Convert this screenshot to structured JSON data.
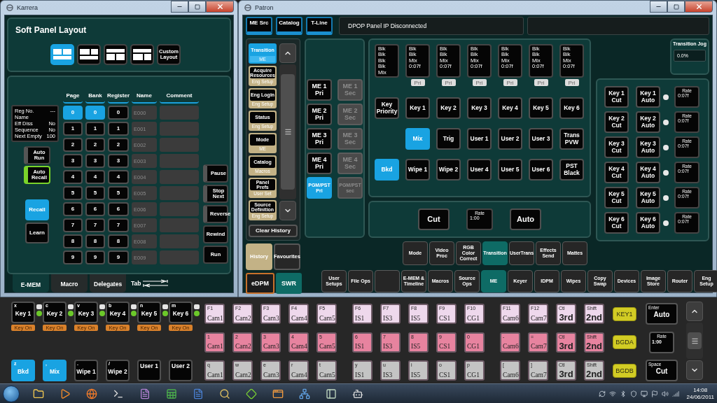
{
  "karrera": {
    "title": "Karrera",
    "layout_panel": {
      "title": "Soft Panel Layout",
      "layouts": [
        {
          "kind": "two-over-one",
          "selected": true
        },
        {
          "kind": "two-over-one",
          "selected": false
        },
        {
          "kind": "one-over-two",
          "selected": false
        },
        {
          "kind": "one-over-two",
          "selected": false
        },
        {
          "kind": "text",
          "label": "Custom Layout",
          "selected": false
        }
      ]
    },
    "info": [
      {
        "label": "Reg No.",
        "value": "---"
      },
      {
        "label": "Name"
      },
      {
        "label": "Eff Diss",
        "value": "No"
      },
      {
        "label": "Sequence",
        "value": "No"
      },
      {
        "label": "Next Empty",
        "value": "100"
      }
    ],
    "toggles": [
      {
        "label": "Auto Run",
        "on": false
      },
      {
        "label": "Auto Recall",
        "on": true
      }
    ],
    "actions": [
      {
        "label": "Recall",
        "selected": true
      },
      {
        "label": "Learn",
        "selected": false
      }
    ],
    "register_table": {
      "columns": [
        "Page",
        "Bank",
        "Register",
        "Name",
        "Comment"
      ],
      "rows": [
        {
          "page": {
            "label": "0",
            "selected": true
          },
          "bank": {
            "label": "0",
            "selected": true
          },
          "register": {
            "label": "0",
            "selected": false
          },
          "name": "E000"
        },
        {
          "page": {
            "label": "1",
            "selected": false
          },
          "bank": {
            "label": "1",
            "selected": false
          },
          "register": {
            "label": "1",
            "selected": false
          },
          "name": "E001"
        },
        {
          "page": {
            "label": "2",
            "selected": false
          },
          "bank": {
            "label": "2",
            "selected": false
          },
          "register": {
            "label": "2",
            "selected": false
          },
          "name": "E002"
        },
        {
          "page": {
            "label": "3",
            "selected": false
          },
          "bank": {
            "label": "3",
            "selected": false
          },
          "register": {
            "label": "3",
            "selected": false
          },
          "name": "E003"
        },
        {
          "page": {
            "label": "4",
            "selected": false
          },
          "bank": {
            "label": "4",
            "selected": false
          },
          "register": {
            "label": "4",
            "selected": false
          },
          "name": "E004"
        },
        {
          "page": {
            "label": "5",
            "selected": false
          },
          "bank": {
            "label": "5",
            "selected": false
          },
          "register": {
            "label": "5",
            "selected": false
          },
          "name": "E005"
        },
        {
          "page": {
            "label": "6",
            "selected": false
          },
          "bank": {
            "label": "6",
            "selected": false
          },
          "register": {
            "label": "6",
            "selected": false
          },
          "name": "E006"
        },
        {
          "page": {
            "label": "7",
            "selected": false
          },
          "bank": {
            "label": "7",
            "selected": false
          },
          "register": {
            "label": "7",
            "selected": false
          },
          "name": "E007"
        },
        {
          "page": {
            "label": "8",
            "selected": false
          },
          "bank": {
            "label": "8",
            "selected": false
          },
          "register": {
            "label": "8",
            "selected": false
          },
          "name": "E008"
        },
        {
          "page": {
            "label": "9",
            "selected": false
          },
          "bank": {
            "label": "9",
            "selected": false
          },
          "register": {
            "label": "9",
            "selected": false
          },
          "name": "E009"
        }
      ]
    },
    "transport": [
      {
        "label": "Pause",
        "kind": "latch"
      },
      {
        "label": "Stop Next",
        "kind": "latch"
      },
      {
        "label": "Reverse",
        "kind": "latch"
      },
      {
        "label": "Rewind",
        "kind": "plain"
      },
      {
        "label": "Run",
        "kind": "plain"
      }
    ],
    "tabs": [
      {
        "label": "E-MEM",
        "selected": true
      },
      {
        "label": "Macro",
        "selected": false
      },
      {
        "label": "Delegates",
        "selected": false
      }
    ],
    "tab_hint": "Tab"
  },
  "patron": {
    "title": "Patron",
    "top_tabs": [
      "ME Src",
      "Catalog",
      "T-Line"
    ],
    "status": "DPOP Panel IP Disconnected",
    "history": [
      {
        "title": "Transition",
        "sub": "ME",
        "selected": true
      },
      {
        "title": "Acquire Resources",
        "sub": "Eng Setup",
        "selected": false
      },
      {
        "title": "Eng Login",
        "sub": "Eng Setup",
        "selected": false
      },
      {
        "title": "Status",
        "sub": "Eng Setup",
        "selected": false
      },
      {
        "title": "Mode",
        "sub": "ME",
        "selected": false
      },
      {
        "title": "Catalog",
        "sub": "Macros",
        "selected": false
      },
      {
        "title": "Panel Prefs",
        "sub": "User Set",
        "selected": false
      },
      {
        "title": "Source Definition",
        "sub": "Eng Setup",
        "selected": false
      }
    ],
    "clear_history": "Clear History",
    "history_tabs": [
      {
        "label": "History",
        "selected": true
      },
      {
        "label": "Favourites",
        "selected": false
      }
    ],
    "modes": [
      {
        "label": "eDPM",
        "selected": false
      },
      {
        "label": "SWR",
        "selected": true
      }
    ],
    "me_pri": [
      {
        "label": "ME 1 Pri",
        "selected": false
      },
      {
        "label": "ME 2 Pri",
        "selected": false
      },
      {
        "label": "ME 3 Pri",
        "selected": false
      },
      {
        "label": "ME 4 Pri",
        "selected": false
      },
      {
        "label": "PGM/PST Pri",
        "selected": true
      }
    ],
    "me_sec": [
      {
        "label": "ME 1 Sec",
        "disabled": true
      },
      {
        "label": "ME 2 Sec",
        "disabled": true
      },
      {
        "label": "ME 3 Sec",
        "disabled": true
      },
      {
        "label": "ME 4 Sec",
        "disabled": true
      },
      {
        "label": "PGM/PST sec",
        "disabled": true
      }
    ],
    "displays": [
      {
        "lines": [
          "Blk",
          "Blk",
          "Blk",
          "Blk",
          "Mix"
        ]
      },
      {
        "lines": [
          "Blk",
          "Blk",
          "Mix",
          "0:07f"
        ],
        "badge": "Pri"
      },
      {
        "lines": [
          "Blk",
          "Blk",
          "Mix",
          "0:07f"
        ],
        "badge": "Pri"
      },
      {
        "lines": [
          "Blk",
          "Blk",
          "Mix",
          "0:07f"
        ],
        "badge": "Pri"
      },
      {
        "lines": [
          "Blk",
          "Blk",
          "Mix",
          "0:07f"
        ],
        "badge": "Pri"
      },
      {
        "lines": [
          "Blk",
          "Blk",
          "Mix",
          "0:07f"
        ],
        "badge": "Pri"
      },
      {
        "lines": [
          "Blk",
          "Blk",
          "Mix",
          "0:07f"
        ],
        "badge": "Pri"
      }
    ],
    "me_grid": [
      [
        {
          "kind": "button",
          "label": "Key Priority",
          "selected": false
        },
        {
          "kind": "button",
          "label": "Key 1",
          "selected": false
        },
        {
          "kind": "button",
          "label": "Key 2",
          "selected": false
        },
        {
          "kind": "button",
          "label": "Key 3",
          "selected": false
        },
        {
          "kind": "button",
          "label": "Key 4",
          "selected": false
        },
        {
          "kind": "button",
          "label": "Key 5",
          "selected": false
        },
        {
          "kind": "button",
          "label": "Key 6",
          "selected": false
        }
      ],
      [
        {
          "kind": "blank"
        },
        {
          "kind": "button",
          "label": "Mix",
          "selected": true
        },
        {
          "kind": "button",
          "label": "Trig",
          "selected": false
        },
        {
          "kind": "button",
          "label": "User 1",
          "selected": false
        },
        {
          "kind": "button",
          "label": "User 2",
          "selected": false
        },
        {
          "kind": "button",
          "label": "User 3",
          "selected": false
        },
        {
          "kind": "button",
          "label": "Trans PVW",
          "selected": false
        }
      ],
      [
        {
          "kind": "button",
          "label": "Bkd",
          "selected": true
        },
        {
          "kind": "button",
          "label": "Wipe 1",
          "selected": false
        },
        {
          "kind": "button",
          "label": "Wipe 2",
          "selected": false
        },
        {
          "kind": "button",
          "label": "User 4",
          "selected": false
        },
        {
          "kind": "button",
          "label": "User 5",
          "selected": false
        },
        {
          "kind": "button",
          "label": "User 6",
          "selected": false
        },
        {
          "kind": "button",
          "label": "PST Black",
          "selected": false
        }
      ]
    ],
    "transition": {
      "cut": "Cut",
      "rate_label": "Rate",
      "rate": "1:00",
      "auto": "Auto"
    },
    "jog": {
      "title": "Transition Jog",
      "value": "0.0%"
    },
    "key_transitions": [
      {
        "cut": "Key 1 Cut",
        "auto": "Key 1 Auto",
        "rate_label": "Rate",
        "rate": "0:07f"
      },
      {
        "cut": "Key 2 Cut",
        "auto": "Key 2 Auto",
        "rate_label": "Rate",
        "rate": "0:07f"
      },
      {
        "cut": "Key 3 Cut",
        "auto": "Key 3 Auto",
        "rate_label": "Rate",
        "rate": "0:07f"
      },
      {
        "cut": "Key 4 Cut",
        "auto": "Key 4 Auto",
        "rate_label": "Rate",
        "rate": "0:07f"
      },
      {
        "cut": "Key 5 Cut",
        "auto": "Key 5 Auto",
        "rate_label": "Rate",
        "rate": "0:07f"
      },
      {
        "cut": "Key 6 Cut",
        "auto": "Key 6 Auto",
        "rate_label": "Rate",
        "rate": "0:07f"
      }
    ],
    "menu_top": [
      {
        "label": "Mode",
        "selected": false
      },
      {
        "label": "Video Proc",
        "selected": false
      },
      {
        "label": "RGB Color Correct",
        "selected": false
      },
      {
        "label": "Transition",
        "selected": true
      },
      {
        "label": "UserTrans",
        "selected": false
      },
      {
        "label": "Effects Send",
        "selected": false
      },
      {
        "label": "Mattes",
        "selected": false
      }
    ],
    "menu_bottom": [
      {
        "label": "User Setups",
        "selected": false
      },
      {
        "label": "File Ops",
        "selected": false
      },
      {
        "selected": false
      },
      {
        "label": "E-MEM & Timeline",
        "selected": false
      },
      {
        "label": "Macros",
        "selected": false
      },
      {
        "label": "Source Ops",
        "selected": false
      },
      {
        "label": "ME",
        "selected": true
      },
      {
        "label": "Keyer",
        "selected": false
      },
      {
        "label": "IDPM",
        "selected": false
      },
      {
        "label": "Wipes",
        "selected": false
      },
      {
        "label": "Copy Swap",
        "selected": false
      },
      {
        "label": "Devices",
        "selected": false
      },
      {
        "label": "Image Store",
        "selected": false
      },
      {
        "label": "Router",
        "selected": false
      },
      {
        "label": "Eng Setup",
        "selected": false
      }
    ]
  },
  "keyboard": {
    "keyers": [
      {
        "key": "x",
        "label": "Key 1",
        "tag": "Key On",
        "on": true
      },
      {
        "key": "c",
        "label": "Key 2",
        "tag": "Key On",
        "on": true
      },
      {
        "key": "v",
        "label": "Key 3",
        "tag": "Key On",
        "on": true
      },
      {
        "key": "b",
        "label": "Key 4",
        "tag": "Key On",
        "on": true
      },
      {
        "key": "n",
        "label": "Key 5",
        "tag": "Key On",
        "on": true
      },
      {
        "key": "m",
        "label": "Key 6",
        "tag": "Key On",
        "on": true
      }
    ],
    "transitions": [
      {
        "key": "z",
        "label": "Bkd",
        "selected": true
      },
      {
        "key": ",",
        "label": "Mix",
        "selected": true
      },
      {
        "key": ".",
        "label": "Wipe 1",
        "selected": false
      },
      {
        "key": "/",
        "label": "Wipe 2",
        "selected": false
      },
      {
        "label": "User 1",
        "selected": false
      },
      {
        "label": "User 2",
        "selected": false
      }
    ],
    "source_rows": [
      {
        "color": "#eed8ec",
        "bus": "KEY1",
        "action": {
          "key": "Enter",
          "label": "Auto"
        },
        "groups": [
          [
            {
              "kind": "source",
              "key": "F1",
              "label": "Cam1"
            },
            {
              "kind": "source",
              "key": "F2",
              "label": "Cam2"
            },
            {
              "kind": "source",
              "key": "F3",
              "label": "Cam3"
            },
            {
              "kind": "source",
              "key": "F4",
              "label": "Cam4"
            },
            {
              "kind": "source",
              "key": "F5",
              "label": "Cam5"
            }
          ],
          [
            {
              "kind": "source",
              "key": "F6",
              "label": "IS1"
            },
            {
              "kind": "source",
              "key": "F7",
              "label": "IS3"
            },
            {
              "kind": "source",
              "key": "F8",
              "label": "IS5"
            },
            {
              "kind": "source",
              "key": "F9",
              "label": "CS1"
            },
            {
              "kind": "source",
              "key": "F10",
              "label": "CG1"
            }
          ],
          [
            {
              "kind": "source",
              "key": "F11",
              "label": "Cam6"
            },
            {
              "kind": "source",
              "key": "F12",
              "label": "Cam7"
            },
            {
              "kind": "modifier",
              "key": "Ctl",
              "label": "3rd"
            },
            {
              "kind": "modifier",
              "key": "Shift",
              "label": "2nd"
            }
          ]
        ]
      },
      {
        "color": "#e7839f",
        "bus": "BGDA",
        "action": {
          "key": "Rate",
          "label": "1:00"
        },
        "groups": [
          [
            {
              "kind": "source",
              "key": "1",
              "label": "Cam1"
            },
            {
              "kind": "source",
              "key": "2",
              "label": "Cam2"
            },
            {
              "kind": "source",
              "key": "3",
              "label": "Cam3"
            },
            {
              "kind": "source",
              "key": "4",
              "label": "Cam4"
            },
            {
              "kind": "source",
              "key": "5",
              "label": "Cam5"
            }
          ],
          [
            {
              "kind": "source",
              "key": "6",
              "label": "IS1"
            },
            {
              "kind": "source",
              "key": "7",
              "label": "IS3"
            },
            {
              "kind": "source",
              "key": "8",
              "label": "IS5"
            },
            {
              "kind": "source",
              "key": "9",
              "label": "CS1"
            },
            {
              "kind": "source",
              "key": "0",
              "label": "CG1"
            }
          ],
          [
            {
              "kind": "source",
              "key": "-",
              "label": "Cam6"
            },
            {
              "kind": "source",
              "key": "=",
              "label": "Cam7"
            },
            {
              "kind": "modifier",
              "key": "Ctl",
              "label": "3rd"
            },
            {
              "kind": "modifier",
              "key": "Shift",
              "label": "2nd"
            }
          ]
        ]
      },
      {
        "color": "#c4c4c4",
        "bus": "BGDB",
        "action": {
          "key": "Space",
          "label": "Cut"
        },
        "groups": [
          [
            {
              "kind": "source",
              "key": "q",
              "label": "Cam1"
            },
            {
              "kind": "source",
              "key": "w",
              "label": "Cam2"
            },
            {
              "kind": "source",
              "key": "e",
              "label": "Cam3"
            },
            {
              "kind": "source",
              "key": "r",
              "label": "Cam4"
            },
            {
              "kind": "source",
              "key": "t",
              "label": "Cam5"
            }
          ],
          [
            {
              "kind": "source",
              "key": "y",
              "label": "IS1"
            },
            {
              "kind": "source",
              "key": "u",
              "label": "IS3"
            },
            {
              "kind": "source",
              "key": "i",
              "label": "IS5"
            },
            {
              "kind": "source",
              "key": "o",
              "label": "CS1"
            },
            {
              "kind": "source",
              "key": "p",
              "label": "CG1"
            }
          ],
          [
            {
              "kind": "source",
              "key": "[",
              "label": "Cam6"
            },
            {
              "kind": "source",
              "key": "]",
              "label": "Cam7"
            },
            {
              "kind": "modifier",
              "key": "Ctl",
              "label": "3rd"
            },
            {
              "kind": "modifier",
              "key": "Shift",
              "label": "2nd"
            }
          ]
        ]
      }
    ]
  },
  "taskbar": {
    "time": "14:08",
    "date": "24/06/2011"
  }
}
